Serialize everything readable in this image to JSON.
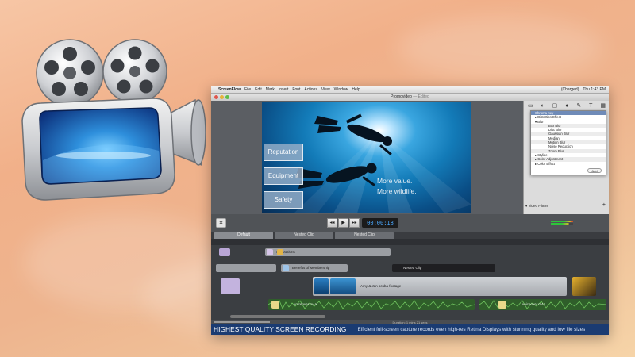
{
  "menubar": {
    "app_name": "ScreenFlow",
    "items": [
      "File",
      "Edit",
      "Mark",
      "Insert",
      "Font",
      "Actions",
      "View",
      "Window",
      "Help"
    ],
    "battery": "(Charged)",
    "clock": "Thu 1:43 PM"
  },
  "window": {
    "title": "Promovideo",
    "status": "— Edited"
  },
  "canvas": {
    "buttons": [
      "Reputation",
      "Equipment",
      "Safety"
    ],
    "overlay_lines": [
      "More value.",
      "More wildlife."
    ]
  },
  "inspector": {
    "popup_items": [
      {
        "label": "Chroma Key",
        "kind": "head"
      },
      {
        "label": "▸ Distortion Effect",
        "kind": "cat"
      },
      {
        "label": "▾ Blur",
        "kind": "cat"
      },
      {
        "label": "Box Blur",
        "kind": "sub"
      },
      {
        "label": "Disc Blur",
        "kind": "sub"
      },
      {
        "label": "Gaussian Blur",
        "kind": "sub"
      },
      {
        "label": "Median",
        "kind": "sub"
      },
      {
        "label": "Motion Blur",
        "kind": "sub"
      },
      {
        "label": "Noise Reduction",
        "kind": "sub"
      },
      {
        "label": "Zoom Blur",
        "kind": "sub"
      },
      {
        "label": "▸ Stylize",
        "kind": "cat"
      },
      {
        "label": "▸ Color Adjustment",
        "kind": "cat"
      },
      {
        "label": "▸ Color Effect",
        "kind": "cat"
      }
    ],
    "add_label": "Add",
    "video_filters_label": "Video Filters",
    "add_video_action_label": "Add Video Action"
  },
  "transport": {
    "timecode": "00:00:18"
  },
  "timeline": {
    "tabs": [
      "Default",
      "Nested Clip",
      "Nested Clip"
    ],
    "annotations_label": "Annotations",
    "membership_label": "Benefits of Membership",
    "nested_clip_label": "Nested Clip",
    "video_clip_label": "Amy & Jan scuba footage",
    "audio_left_label": "voiceover.m4a",
    "audio_right_label": "voiceover.m4a",
    "duration": "Duration: 1 mins 21 secs"
  },
  "banner": {
    "headline": "HIGHEST QUALITY SCREEN RECORDING",
    "subtext": "Efficient full-screen capture records even high-res Retina Displays with stunning quality and low file sizes"
  }
}
